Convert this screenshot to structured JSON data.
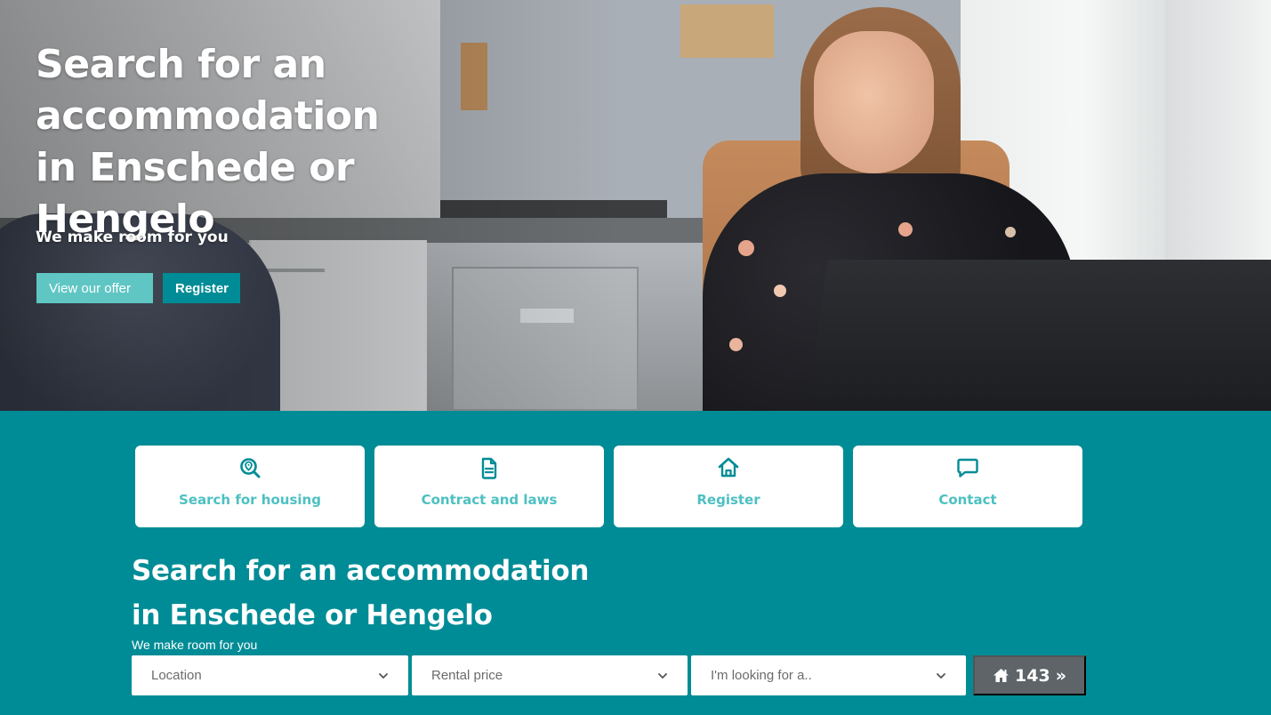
{
  "hero": {
    "title_line1": "Search for an",
    "title_line2": "accommodation",
    "title_line3": "in Enschede or Hengelo",
    "subtitle": "We make room for you",
    "btn_offer": "View our offer",
    "btn_register": "Register"
  },
  "tiles": [
    {
      "label": "Search for housing",
      "icon": "location-search-icon"
    },
    {
      "label": "Contract and laws",
      "icon": "document-icon"
    },
    {
      "label": "Register",
      "icon": "house-icon"
    },
    {
      "label": "Contact",
      "icon": "chat-bubble-icon"
    }
  ],
  "search": {
    "title_line1": "Search for an accommodation",
    "title_line2": "in Enschede or Hengelo",
    "subtitle": "We make room for you",
    "location": "Location",
    "rental_price": "Rental price",
    "looking_for": "I'm looking for a..",
    "count": "143",
    "count_arrow": "»"
  },
  "colors": {
    "teal": "#008c96",
    "tile_text": "#4ec0c2",
    "light_teal_button": "#5fc6c4",
    "count_button": "#5e6468"
  }
}
